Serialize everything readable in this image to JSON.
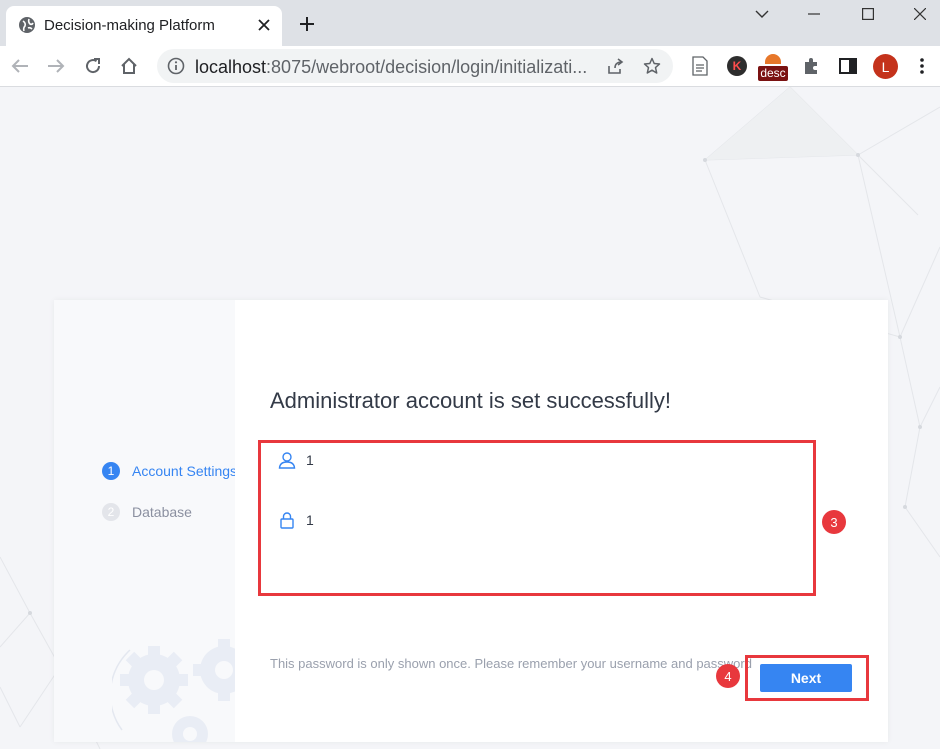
{
  "browser": {
    "tab_title": "Decision-making Platform",
    "url_host": "localhost",
    "url_rest": ":8075/webroot/decision/login/initializati...",
    "profile_initial": "L",
    "ext_k_label": "K",
    "ext_desc_label": "desc"
  },
  "sidebar": {
    "steps": [
      {
        "number": "1",
        "label": "Account Settings",
        "state": "active"
      },
      {
        "number": "2",
        "label": "Database",
        "state": "inactive"
      }
    ]
  },
  "main": {
    "title": "Administrator account is set successfully!",
    "username_value": "1",
    "password_value": "1",
    "hint": "This password is only shown once. Please remember your username and password",
    "next_label": "Next"
  },
  "annotations": [
    {
      "number": "3"
    },
    {
      "number": "4"
    }
  ],
  "colors": {
    "accent": "#3685f2",
    "annotation": "#e8383d"
  }
}
